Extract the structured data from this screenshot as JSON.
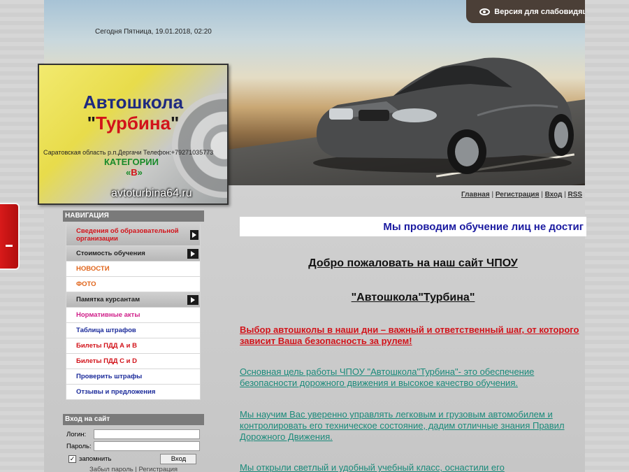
{
  "header": {
    "date_text": "Сегодня Пятница, 19.01.2018, 02:20",
    "vision_button": "Версия для слабовидящих",
    "vision_icon": "eye-icon"
  },
  "logo": {
    "title_line1": "Автошкола",
    "title_quote_open": "\"",
    "title_line2": "Турбина",
    "title_quote_close": "\"",
    "address": "Саратовская область р.п.Дергачи Телефон:+79271035773",
    "category_label": "КАТЕГОРИИ",
    "category_prefix": "«",
    "category_value": "В",
    "category_suffix": "»",
    "url": "avtoturbina64.ru"
  },
  "top_links": {
    "home": "Главная",
    "register": "Регистрация",
    "login": "Вход",
    "rss": "RSS",
    "separator": "|"
  },
  "navigation": {
    "title": "НАВИГАЦИЯ",
    "items": [
      {
        "label": "Сведения об образовательной организации",
        "color": "#d2131a",
        "has_arrow": true
      },
      {
        "label": "Стоимость обучения",
        "color": "#222222",
        "has_arrow": true
      },
      {
        "label": "НОВОСТИ",
        "color": "#e0641a",
        "has_arrow": false
      },
      {
        "label": "ФОТО",
        "color": "#e0641a",
        "has_arrow": false
      },
      {
        "label": "Памятка курсантам",
        "color": "#222222",
        "has_arrow": true
      },
      {
        "label": "Нормативные акты",
        "color": "#d0208a",
        "has_arrow": false
      },
      {
        "label": "Таблица штрафов",
        "color": "#1a2a9a",
        "has_arrow": false
      },
      {
        "label": "Билеты ПДД А и В",
        "color": "#d2131a",
        "has_arrow": false
      },
      {
        "label": "Билеты ПДД С и D",
        "color": "#d2131a",
        "has_arrow": false
      },
      {
        "label": "Проверить штрафы",
        "color": "#1a2a9a",
        "has_arrow": false
      },
      {
        "label": "Отзывы и предложения",
        "color": "#1a2a9a",
        "has_arrow": false
      }
    ]
  },
  "login": {
    "title": "Вход на сайт",
    "login_label": "Логин:",
    "password_label": "Пароль:",
    "remember_label": "запомнить",
    "button": "Вход",
    "forgot": "Забыл пароль",
    "separator": "|",
    "register": "Регистрация"
  },
  "main": {
    "marquee": "Мы проводим обучение лиц не достиг",
    "welcome_line1": "Добро пожаловать на наш сайт ЧПОУ",
    "welcome_line2": "\"Автошкола\"Турбина\"",
    "paragraph_red": " Выбор автошколы в наши дни – важный и ответственный шаг, от которого зависит Ваша безопасность за рулем!",
    "paragraph_1": "Основная цель работы  ЧПОУ \"Автошкола\"Турбина\"- это обеспечение безопасности дорожного движения и высокое качество обучения.",
    "paragraph_2": "Мы научим Вас уверенно управлять легковым и грузовым автомобилем и контролировать его техническое состояние, дадим отличные знания Правил Дорожного Движения.",
    "paragraph_3": "Мы открыли светлый и удобный учебный класс, оснастили его"
  },
  "colors": {
    "accent_red": "#d2131a",
    "link_teal": "#1a8a7a",
    "marquee_blue": "#1a1aa0"
  }
}
